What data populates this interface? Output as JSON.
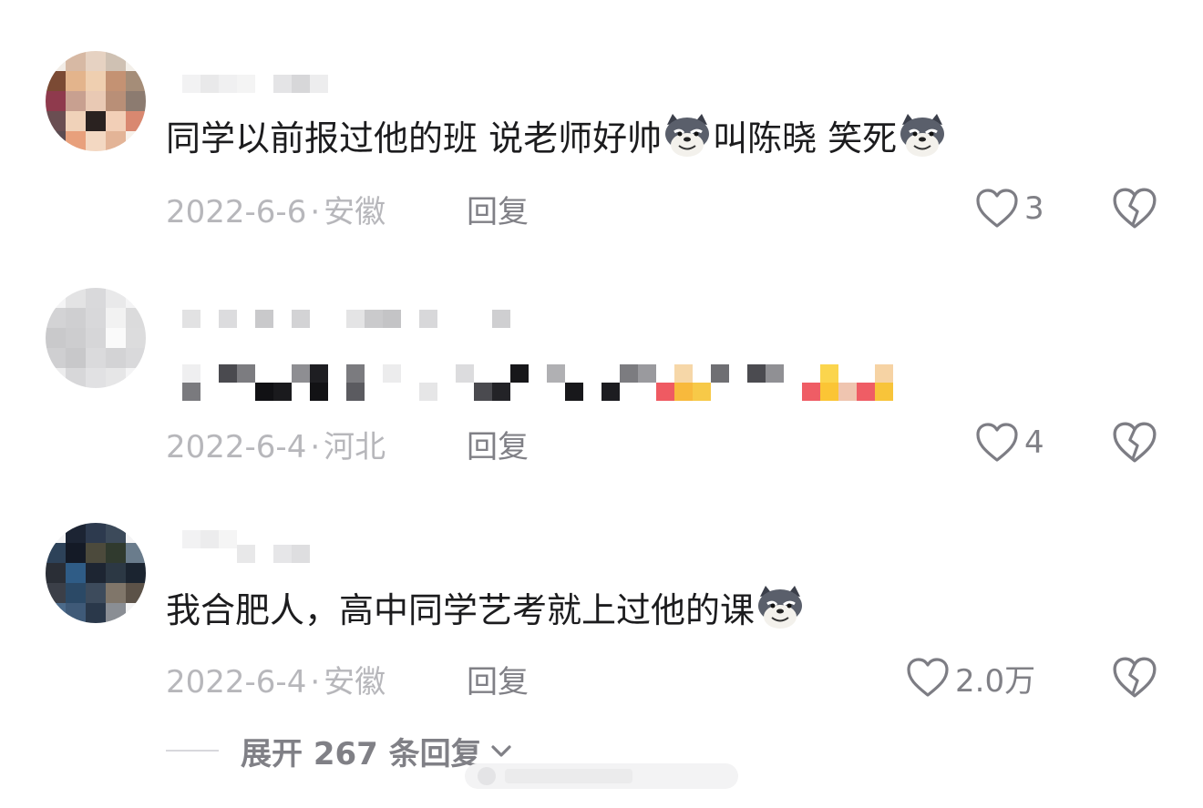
{
  "comments": [
    {
      "text_before": "同学以前报过他的班 说老师好帅",
      "text_middle": "叫陈晓  笑死",
      "emoji_name": "wolf-grin-emoji",
      "date": "2022-6-6",
      "location": "安徽",
      "reply_label": "回复",
      "likes": "3"
    },
    {
      "date": "2022-6-4",
      "location": "河北",
      "reply_label": "回复",
      "likes": "4"
    },
    {
      "text": "我合肥人，高中同学艺考就上过他的课",
      "emoji_name": "wolf-grin-emoji",
      "date": "2022-6-4",
      "location": "安徽",
      "reply_label": "回复",
      "likes": "2.0万"
    }
  ],
  "expand": {
    "label": "展开 267 条回复"
  },
  "icons": {
    "like": "heart-outline-icon",
    "dislike": "broken-heart-icon",
    "expand": "chevron-down-icon"
  },
  "colors": {
    "text": "#1c1c1e",
    "meta": "#b7b7bb",
    "secondary": "#808086",
    "icon": "#7d7d84"
  }
}
